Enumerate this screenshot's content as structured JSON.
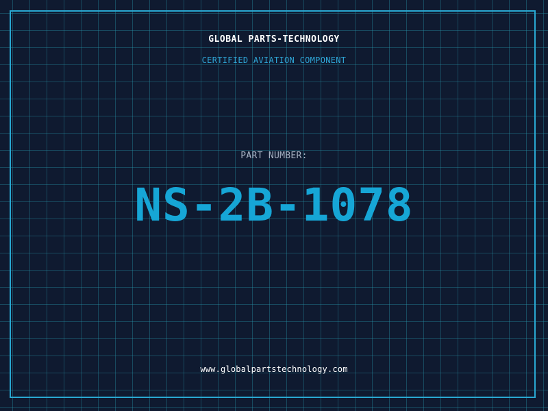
{
  "header": {
    "company": "GLOBAL PARTS-TECHNOLOGY",
    "subtitle": "CERTIFIED AVIATION COMPONENT"
  },
  "part": {
    "label": "PART NUMBER:",
    "number": "NS-2B-1078"
  },
  "footer": {
    "url": "www.globalpartstechnology.com"
  },
  "colors": {
    "background": "#0f1a30",
    "grid": "#2896aa",
    "accent": "#29a8d2",
    "part_number": "#16a6d6",
    "label": "#a8b3c4",
    "text": "#ffffff"
  }
}
